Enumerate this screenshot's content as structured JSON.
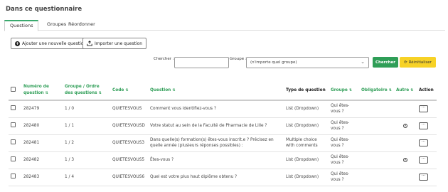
{
  "page_title": "Dans ce questionnaire",
  "tabs": [
    {
      "label": "Questions",
      "active": true
    },
    {
      "label": "Groupes",
      "active": false
    },
    {
      "label": "Réordonner",
      "active": false
    }
  ],
  "toolbar": {
    "add_label": "Ajouter une nouvelle question",
    "import_label": "Importer une question"
  },
  "filter": {
    "search_label": "Chercher :",
    "search_value": "",
    "group_label": "Groupe :",
    "group_selected": "(n'importe quel groupe)",
    "search_button": "Chercher",
    "reset_button": "Réinitialiser"
  },
  "colors": {
    "accent": "#2f9e57",
    "reset": "#f7d226"
  },
  "table": {
    "columns": [
      "Numéro de question",
      "Groupe / Ordre des questions",
      "Code",
      "Question",
      "Type de question",
      "Groupe",
      "Obligatoire",
      "Autre",
      "Action"
    ],
    "rows": [
      {
        "id": "282479",
        "order": "1 / 0",
        "code": "QUIETESVOUS",
        "question": "Comment vous identifiez-vous ?",
        "type": "List (Dropdown)",
        "group": "Qui êtes-vous ?",
        "mandatory": "",
        "other": false
      },
      {
        "id": "282480",
        "order": "1 / 1",
        "code": "QUIETESVOUSD",
        "question": "Votre statut au sein de la Faculté de Pharmacie de Lille ?",
        "type": "List (Dropdown)",
        "group": "Qui êtes-vous ?",
        "mandatory": "",
        "other": true
      },
      {
        "id": "282481",
        "order": "1 / 2",
        "code": "QUIETESVOUS3",
        "question": "Dans quelle(s) formation(s) êtes-vous inscrit.e ? Précisez en quelle année (plusieurs réponses possibles) :",
        "type": "Multiple choice with comments",
        "group": "Qui êtes-vous ?",
        "mandatory": "",
        "other": false
      },
      {
        "id": "282482",
        "order": "1 / 3",
        "code": "QUIETESVOUS5",
        "question": "Êtes-vous ?",
        "type": "List (Dropdown)",
        "group": "Qui êtes-vous ?",
        "mandatory": "",
        "other": true
      },
      {
        "id": "282483",
        "order": "1 / 4",
        "code": "QUIETESVOUS6",
        "question": "Quel est votre plus haut diplôme obtenu ?",
        "type": "List (Dropdown)",
        "group": "Qui êtes-vous ?",
        "mandatory": "",
        "other": false
      }
    ]
  }
}
